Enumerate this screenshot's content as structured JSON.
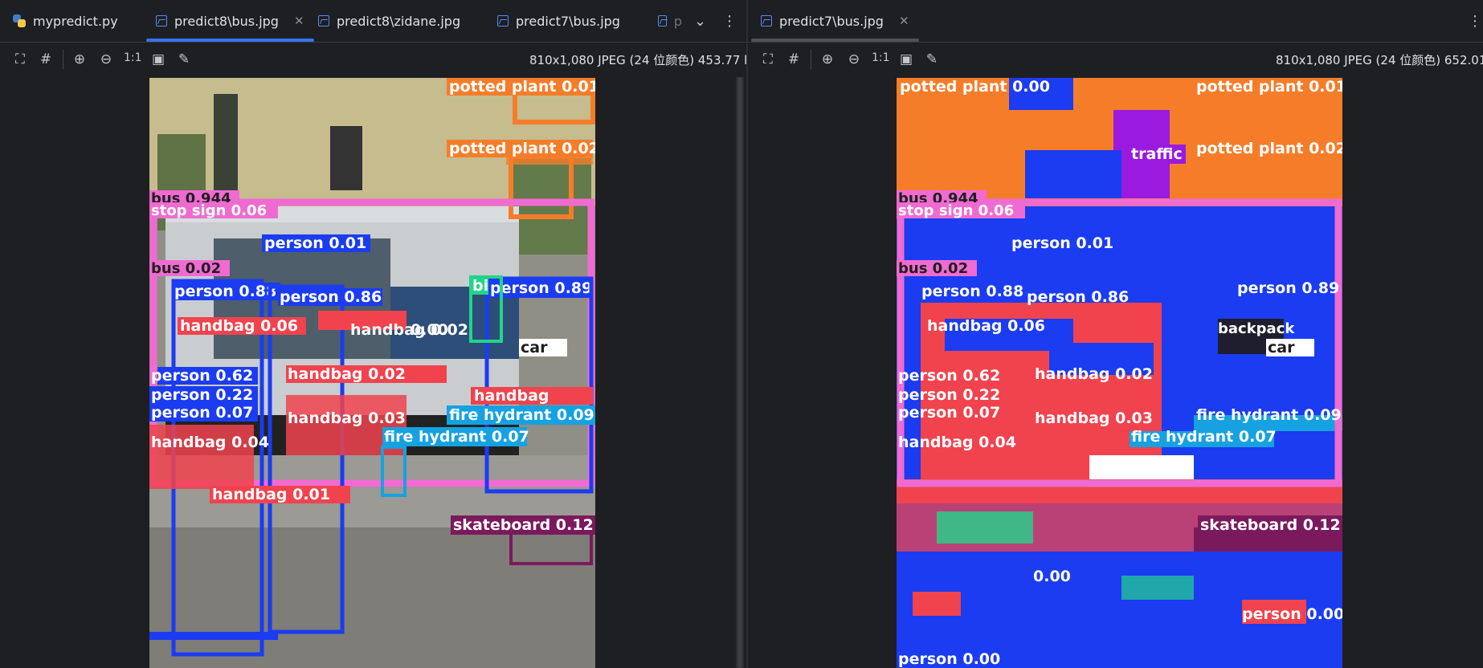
{
  "left_pane": {
    "tabs": [
      {
        "label": "mypredict.py",
        "icon": "python-file-icon"
      },
      {
        "label": "predict8\\bus.jpg",
        "icon": "image-file-icon"
      },
      {
        "label": "predict8\\zidane.jpg",
        "icon": "image-file-icon"
      },
      {
        "label": "predict7\\bus.jpg",
        "icon": "image-file-icon"
      },
      {
        "label": "p",
        "icon": "image-file-icon"
      }
    ],
    "active_tab": "predict8\\bus.jpg",
    "toolbar": {
      "one_to_one": "1:1"
    },
    "image_info": "810x1,080 JPEG (24 位颜色) 453.77 kB"
  },
  "right_pane": {
    "tabs": [
      {
        "label": "predict7\\bus.jpg",
        "icon": "image-file-icon"
      }
    ],
    "toolbar": {
      "one_to_one": "1:1"
    },
    "image_info": "810x1,080 JPEG (24 位颜色) 652.01 kB"
  },
  "left_image": {
    "labels": {
      "potted_plant_1": "potted plant 0.01",
      "potted_plant_2": "potted plant 0.02",
      "bus_main": "bus 0.944",
      "stop_sign": "stop sign 0.06",
      "person_001": "person 0.01",
      "bus_002": "bus 0.02",
      "person_088": "person 0.88",
      "person_086": "person 0.86",
      "person_089": "person 0.89",
      "handbag_006": "handbag 0.06",
      "handbag_002a": "handbag 0.02",
      "val_000": "0.00",
      "car": "car",
      "person_062": "person 0.62",
      "person_022": "person 0.22",
      "person_007": "person 0.07",
      "handbag_002b": "handbag 0.02",
      "handbag_003": "handbag 0.03",
      "handbag_004": "handbag 0.04",
      "handbag_001": "handbag 0.01",
      "fire_hydrant_009": "fire hydrant 0.09",
      "fire_hydrant_007": "fire hydrant 0.07",
      "skateboard": "skateboard 0.12",
      "bike_partial": "bi",
      "handbag_right": "handbag"
    },
    "colors": {
      "pink": "#f06bd1",
      "blue": "#1b3cf0",
      "orange": "#f57d2a",
      "red": "#f0434e",
      "cyan": "#16a2e0",
      "green": "#22d48b",
      "purple": "#7a1a5c"
    }
  },
  "right_image": {
    "labels": {
      "potted_plant_1": "potted plant 0.01",
      "potted_plant_2": "potted plant 0.02",
      "potted_plant_0": "potted plant 0.00",
      "bus_main": "bus 0.944",
      "stop_sign": "stop sign 0.06",
      "person_001": "person 0.01",
      "bus_002": "bus 0.02",
      "person_088": "person 0.88",
      "person_086": "person 0.86",
      "person_089": "person 0.89",
      "handbag_006": "handbag 0.06",
      "person_062": "person 0.62",
      "person_022": "person 0.22",
      "person_007": "person 0.07",
      "handbag_002b": "handbag 0.02",
      "handbag_003": "handbag 0.03",
      "handbag_004": "handbag 0.04",
      "fire_hydrant_009": "fire hydrant 0.09",
      "fire_hydrant_007": "fire hydrant 0.07",
      "skateboard": "skateboard 0.12",
      "traffic": "traffic",
      "car": "car",
      "backpack": "backpack",
      "person_000": "person 0.00",
      "val_000": "0.00",
      "person_000b": "person 0.00"
    }
  }
}
